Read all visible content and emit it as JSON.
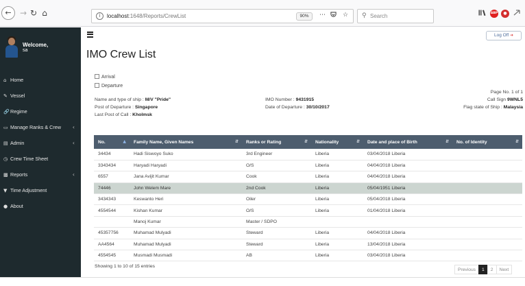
{
  "browser": {
    "url_host": "localhost",
    "url_path": ":1648/Reports/CrewList",
    "zoom": "90%",
    "search_placeholder": "Search",
    "abp_label": "ABP"
  },
  "sidebar": {
    "welcome": "Welcome,",
    "username": "sa",
    "items": [
      {
        "label": "Home",
        "icon": "home-icon",
        "chevron": false
      },
      {
        "label": "Vessel",
        "icon": "edit-icon",
        "chevron": false
      },
      {
        "label": "Regime",
        "icon": "link-icon",
        "chevron": false
      },
      {
        "label": "Manage Ranks & Crew",
        "icon": "monitor-icon",
        "chevron": true
      },
      {
        "label": "Admin",
        "icon": "table-icon",
        "chevron": true
      },
      {
        "label": "Crew Time Sheet",
        "icon": "clock-icon",
        "chevron": false
      },
      {
        "label": "Reports",
        "icon": "chart-icon",
        "chevron": true
      },
      {
        "label": "Time Adjustment",
        "icon": "filter-icon",
        "chevron": false
      },
      {
        "label": "About",
        "icon": "user-icon",
        "chevron": false
      }
    ]
  },
  "header": {
    "logoff_label": "Log Off"
  },
  "page": {
    "title": "IMO Crew List",
    "arrival_label": "Arrival",
    "departure_label": "Departure",
    "ship_label": "Name and type of ship :",
    "ship_value": "M/V \"Pride\"",
    "port_departure_label": "Post of Departure :",
    "port_departure_value": "Singapore",
    "last_port_label": "Last Post of Call :",
    "last_port_value": "Kholmsk",
    "imo_label": "IMO Number :",
    "imo_value": "9431915",
    "date_departure_label": "Date of Departure :",
    "date_departure_value": "30/10/2017",
    "page_no": "Page No. 1 of 1",
    "call_sign_label": "Call Sign",
    "call_sign_value": "9WNL5",
    "flag_label": "Flag state of Ship :",
    "flag_value": "Malaysia"
  },
  "table": {
    "headers": [
      "No.",
      "Family Name, Given Names",
      "Ranks or Rating",
      "Nationality",
      "Date and place of Birth",
      "No. of Identity"
    ],
    "selected_row": 3,
    "rows": [
      [
        "34434",
        "Hadi Siswoyo Suko",
        "3rd Engineer",
        "Liberia",
        "03/04/2018 Liberia",
        ""
      ],
      [
        "3343434",
        "Haryadi Haryadi",
        "O/S",
        "Liberia",
        "04/04/2018 Liberia",
        ""
      ],
      [
        "6557",
        "Jana Avijit Kumar",
        "Cook",
        "Liberia",
        "04/04/2018 Liberia",
        ""
      ],
      [
        "74446",
        "John Welem Mare",
        "2nd Cook",
        "Liberia",
        "05/04/1951 Liberia",
        ""
      ],
      [
        "3434343",
        "Keswanto Heri",
        "Oiler",
        "Liberia",
        "05/04/2018 Liberia",
        ""
      ],
      [
        "4554544",
        "Kishan Kumar",
        "O/S",
        "Liberia",
        "01/04/2018 Liberia",
        ""
      ],
      [
        "",
        "Manoj Kumar",
        "Master / SDPO",
        "",
        "",
        ""
      ],
      [
        "45357756",
        "Muhamad Mulyadi",
        "Steward",
        "Liberia",
        "04/04/2018 Liberia",
        ""
      ],
      [
        "AA4564",
        "Muhamad Mulyadi",
        "Steward",
        "Liberia",
        "13/04/2018 Liberia",
        ""
      ],
      [
        "4554545",
        "Musmadi Musmadi",
        "AB",
        "Liberia",
        "03/04/2018 Liberia",
        ""
      ]
    ],
    "showing": "Showing 1 to 10 of 15 entries",
    "pager": {
      "previous": "Previous",
      "pages": [
        "1",
        "2"
      ],
      "next": "Next",
      "active": "1"
    }
  }
}
